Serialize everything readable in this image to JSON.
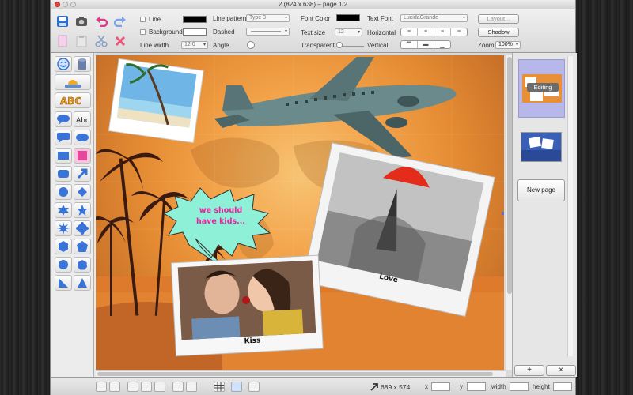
{
  "window": {
    "title": "2 (824 x 638) – page 1/2"
  },
  "toolbar": {
    "line_label": "Line",
    "background_label": "Background",
    "line_width_label": "Line width",
    "line_width_value": "12.0",
    "line_pattern_label": "Line pattern",
    "line_pattern_value": "Type 3",
    "dashed_label": "Dashed",
    "angle_label": "Angle",
    "font_color_label": "Font Color",
    "text_size_label": "Text size",
    "text_size_value": "12",
    "transparent_label": "Transparent",
    "text_font_label": "Text Font",
    "text_font_value": "LucidaGrande",
    "horizontal_label": "Horizontal",
    "vertical_label": "Vertical",
    "layout_label": "Layout...",
    "shadow_label": "Shadow",
    "zoom_label": "Zoom",
    "zoom_value": "100%"
  },
  "canvas": {
    "bubble_text": "we should have kids...",
    "photo_kiss_caption": "Kiss",
    "photo_love_caption": "Love"
  },
  "rightpanel": {
    "page1_badge": "Editing",
    "new_page_label": "New page",
    "add_label": "+",
    "remove_label": "×"
  },
  "statusbar": {
    "size_readout": "689 x 574",
    "x_label": "x",
    "y_label": "y",
    "width_label": "width",
    "height_label": "height"
  },
  "colors": {
    "accent_blue": "#4a7bd6",
    "bubble_fill": "#8ff0d8",
    "bubble_text": "#f01fa2",
    "sunset_orange": "#f3a34a"
  }
}
